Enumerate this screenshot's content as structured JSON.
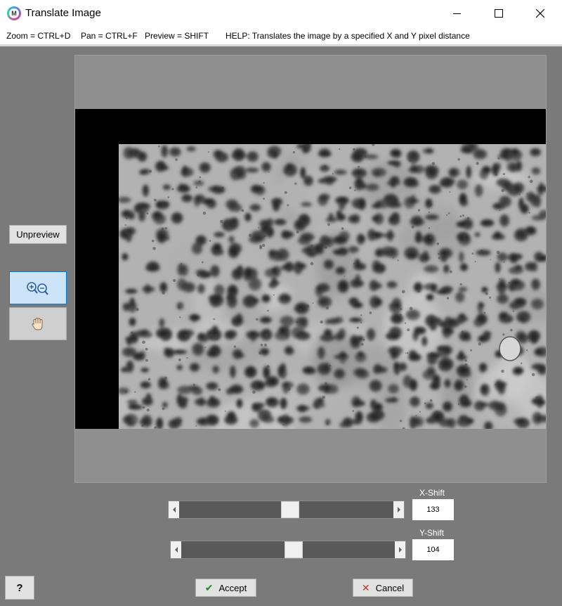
{
  "window": {
    "title": "Translate Image",
    "app_icon_letter": "M",
    "controls": [
      "minimize-icon",
      "maximize-icon",
      "close-icon"
    ]
  },
  "helpbar": {
    "zoom": "Zoom = CTRL+D",
    "pan": "Pan = CTRL+F",
    "preview": "Preview = SHIFT",
    "help": "HELP:  Translates the image by a specified X and Y pixel distance"
  },
  "tools": {
    "unpreview_label": "Unpreview",
    "zoom_icon": "zoom-in-out-icon",
    "pan_icon": "hand-pan-icon",
    "active_tool": "zoom"
  },
  "x_shift": {
    "label": "X-Shift",
    "value": "133",
    "slider_position": 0.52
  },
  "y_shift": {
    "label": "Y-Shift",
    "value": "104",
    "slider_position": 0.53
  },
  "footer": {
    "help_label": "?",
    "accept_label": "Accept",
    "accept_icon": "check-icon",
    "cancel_label": "Cancel",
    "cancel_icon": "x-icon"
  },
  "colors": {
    "client_background": "#7a7a7a",
    "check_green": "#1a8a2a",
    "cancel_red": "#c0392b",
    "active_tool_bg": "#cce4f7",
    "active_tool_border": "#0078d7"
  }
}
